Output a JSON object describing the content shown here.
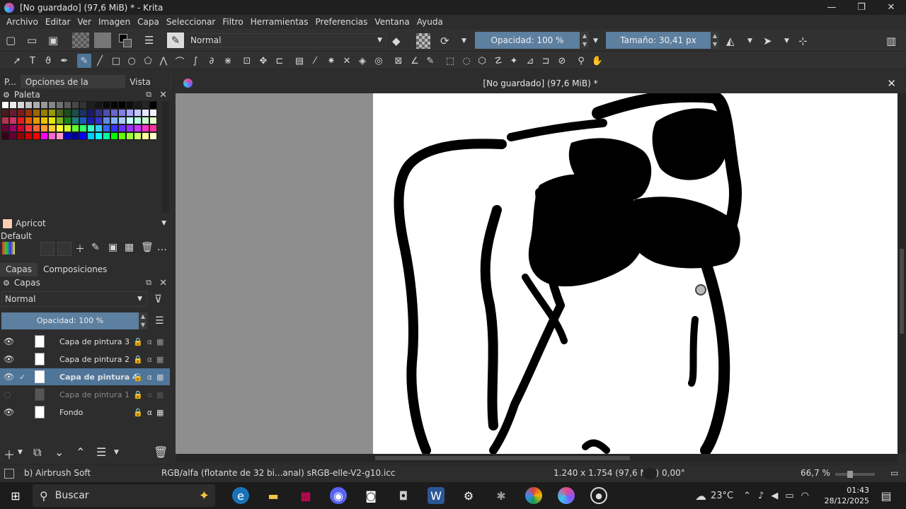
{
  "window": {
    "title": "[No guardado]  (97,6 MiB) * - Krita",
    "minimize": "—",
    "maximize": "❐",
    "close": "✕"
  },
  "menu": [
    "Archivo",
    "Editar",
    "Ver",
    "Imagen",
    "Capa",
    "Seleccionar",
    "Filtro",
    "Herramientas",
    "Preferencias",
    "Ventana",
    "Ayuda"
  ],
  "toolbar": {
    "blend_mode": "Normal",
    "opacity_label": "Opacidad: 100 %",
    "size_label": "Tamaño: 30,41 px"
  },
  "dock_tabs": [
    "P...",
    "Opciones de la herra...",
    "Vista g..."
  ],
  "palette": {
    "title": "Paleta",
    "current_color_name": "Apricot",
    "current_color": "#fbceb1",
    "palette_name": "Default",
    "swatches": [
      "#ffffff",
      "#ebebeb",
      "#d6d6d6",
      "#c2c2c2",
      "#adadad",
      "#999999",
      "#858585",
      "#707070",
      "#5c5c5c",
      "#474747",
      "#333333",
      "#1f1f1f",
      "#141414",
      "#0a0a0a",
      "#050505",
      "#000000",
      "#0d0d0d",
      "#1a1a1a",
      "#262626",
      "#000000",
      "#4d1a1a",
      "#661a33",
      "#801a1a",
      "#993300",
      "#996600",
      "#997f00",
      "#999900",
      "#4d661a",
      "#1a4d1a",
      "#1a4d4d",
      "#1a3366",
      "#1a1a66",
      "#33338c",
      "#4d4db3",
      "#6666cc",
      "#8080e6",
      "#a6a6ff",
      "#c6c6ff",
      "#e6e6ff",
      "#f2f2ff",
      "#b3334d",
      "#cc3366",
      "#e61a1a",
      "#e65c00",
      "#e69900",
      "#e6c200",
      "#e6e600",
      "#80b31a",
      "#1a801a",
      "#1a8080",
      "#1a5cb3",
      "#1a1ab3",
      "#3333cc",
      "#5c8ae6",
      "#80b3ff",
      "#a6ccff",
      "#ccffff",
      "#b3ffe6",
      "#ccffcc",
      "#e6ffcc",
      "#660033",
      "#990066",
      "#cc0033",
      "#ff3333",
      "#ff6633",
      "#ff9933",
      "#ffcc33",
      "#ffff33",
      "#ccff33",
      "#66ff33",
      "#33ff66",
      "#33ffcc",
      "#33ccff",
      "#3366ff",
      "#3333ff",
      "#6633ff",
      "#9933ff",
      "#cc33ff",
      "#ff33cc",
      "#ff3399",
      "#330019",
      "#660033",
      "#990000",
      "#cc0000",
      "#ff0000",
      "#ff00ff",
      "#ff66cc",
      "#ff99cc",
      "#0000cc",
      "#000099",
      "#0000ff",
      "#00ccff",
      "#00ffff",
      "#00ff99",
      "#00ff00",
      "#66ff00",
      "#99ff33",
      "#ccff66",
      "#ffff99",
      "#ffffcc"
    ]
  },
  "layers_tabs": [
    "Capas",
    "Composiciones"
  ],
  "layers": {
    "title": "Capas",
    "blend_mode": "Normal",
    "opacity_label": "Opacidad:  100 %",
    "items": [
      {
        "name": "Capa de pintura 3",
        "visible": true,
        "selected": false
      },
      {
        "name": "Capa de pintura 2",
        "visible": true,
        "selected": false
      },
      {
        "name": "Capa de pintura 4",
        "visible": true,
        "selected": true,
        "check": "✓"
      },
      {
        "name": "Capa de pintura 1",
        "visible": false,
        "selected": false
      },
      {
        "name": "Fondo",
        "visible": true,
        "selected": false,
        "locked": true
      }
    ]
  },
  "document": {
    "tab_title": "[No guardado]  (97,6 MiB) *",
    "close": "✕"
  },
  "status": {
    "brush": "b) Airbrush Soft",
    "color_space": "RGB/alfa (flotante de 32 bi...anal)  sRGB-elle-V2-g10.icc",
    "dimensions": "1.240 x 1.754 (97,6 MiB)",
    "rotation": "0,00°",
    "zoom": "66,7 %"
  },
  "taskbar": {
    "search_placeholder": "Buscar",
    "weather": "23°C",
    "time": "01:43",
    "date": "28/12/2025"
  }
}
